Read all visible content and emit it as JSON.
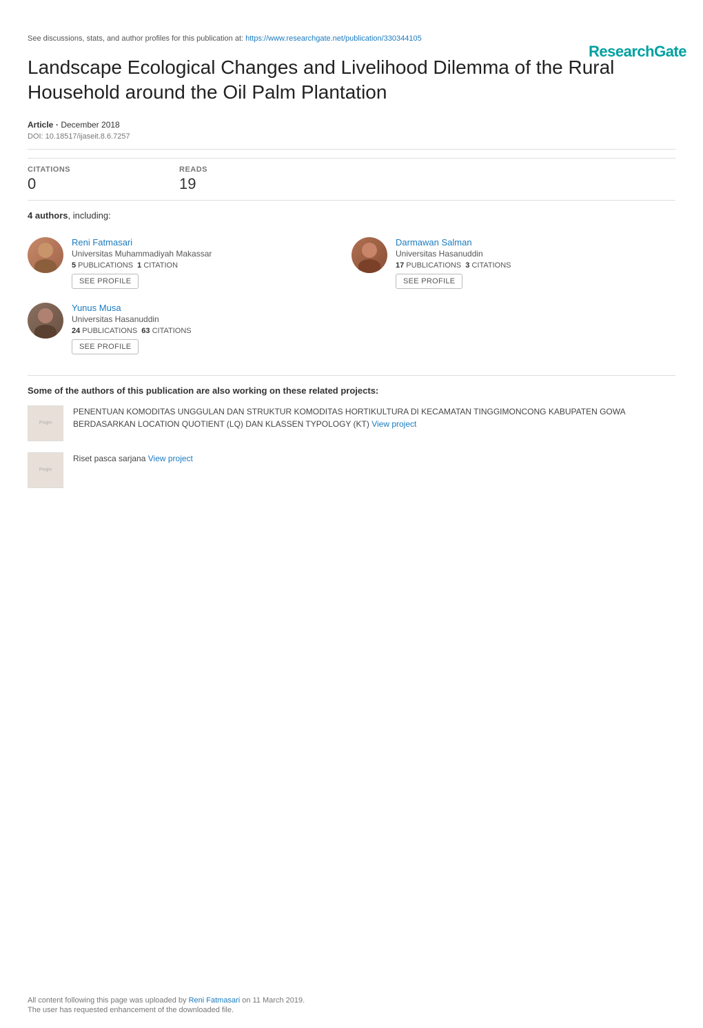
{
  "header": {
    "logo": "ResearchGate"
  },
  "top_notice": {
    "text_before": "See discussions, stats, and author profiles for this publication at: ",
    "url": "https://www.researchgate.net/publication/330344105",
    "url_label": "https://www.researchgate.net/publication/330344105"
  },
  "paper": {
    "title": "Landscape Ecological Changes and Livelihood Dilemma of the Rural Household around the Oil Palm Plantation",
    "type_label": "Article",
    "date": "December 2018",
    "doi_label": "DOI: 10.18517/ijaseit.8.6.7257"
  },
  "stats": {
    "citations_label": "CITATIONS",
    "citations_value": "0",
    "reads_label": "READS",
    "reads_value": "19"
  },
  "authors": {
    "header": "4 authors, including:",
    "list": [
      {
        "name": "Reni Fatmasari",
        "affiliation": "Universitas Muhammadiyah Makassar",
        "publications": "5",
        "publications_label": "PUBLICATIONS",
        "citations": "1",
        "citations_label": "CITATION",
        "see_profile": "SEE PROFILE",
        "avatar_class": "avatar-reni"
      },
      {
        "name": "Darmawan Salman",
        "affiliation": "Universitas Hasanuddin",
        "publications": "17",
        "publications_label": "PUBLICATIONS",
        "citations": "3",
        "citations_label": "CITATIONS",
        "see_profile": "SEE PROFILE",
        "avatar_class": "avatar-darmawan"
      },
      {
        "name": "Yunus Musa",
        "affiliation": "Universitas Hasanuddin",
        "publications": "24",
        "publications_label": "PUBLICATIONS",
        "citations": "63",
        "citations_label": "CITATIONS",
        "see_profile": "SEE PROFILE",
        "avatar_class": "avatar-yunus"
      }
    ]
  },
  "related_projects": {
    "header": "Some of the authors of this publication are also working on these related projects:",
    "projects": [
      {
        "thumbnail_label": "Projm",
        "text": "PENENTUAN KOMODITAS UNGGULAN DAN STRUKTUR KOMODITAS HORTIKULTURA DI KECAMATAN TINGGIMONCONG KABUPATEN GOWA BERDASARKAN LOCATION QUOTIENT (LQ) DAN KLASSEN TYPOLOGY (KT)",
        "view_link": "View project"
      },
      {
        "thumbnail_label": "Projm",
        "text": "Riset pasca sarjana",
        "view_link": "View project"
      }
    ]
  },
  "footer": {
    "line1_before": "All content following this page was uploaded by ",
    "uploader": "Reni Fatmasari",
    "line1_after": " on 11 March 2019.",
    "line2": "The user has requested enhancement of the downloaded file."
  }
}
